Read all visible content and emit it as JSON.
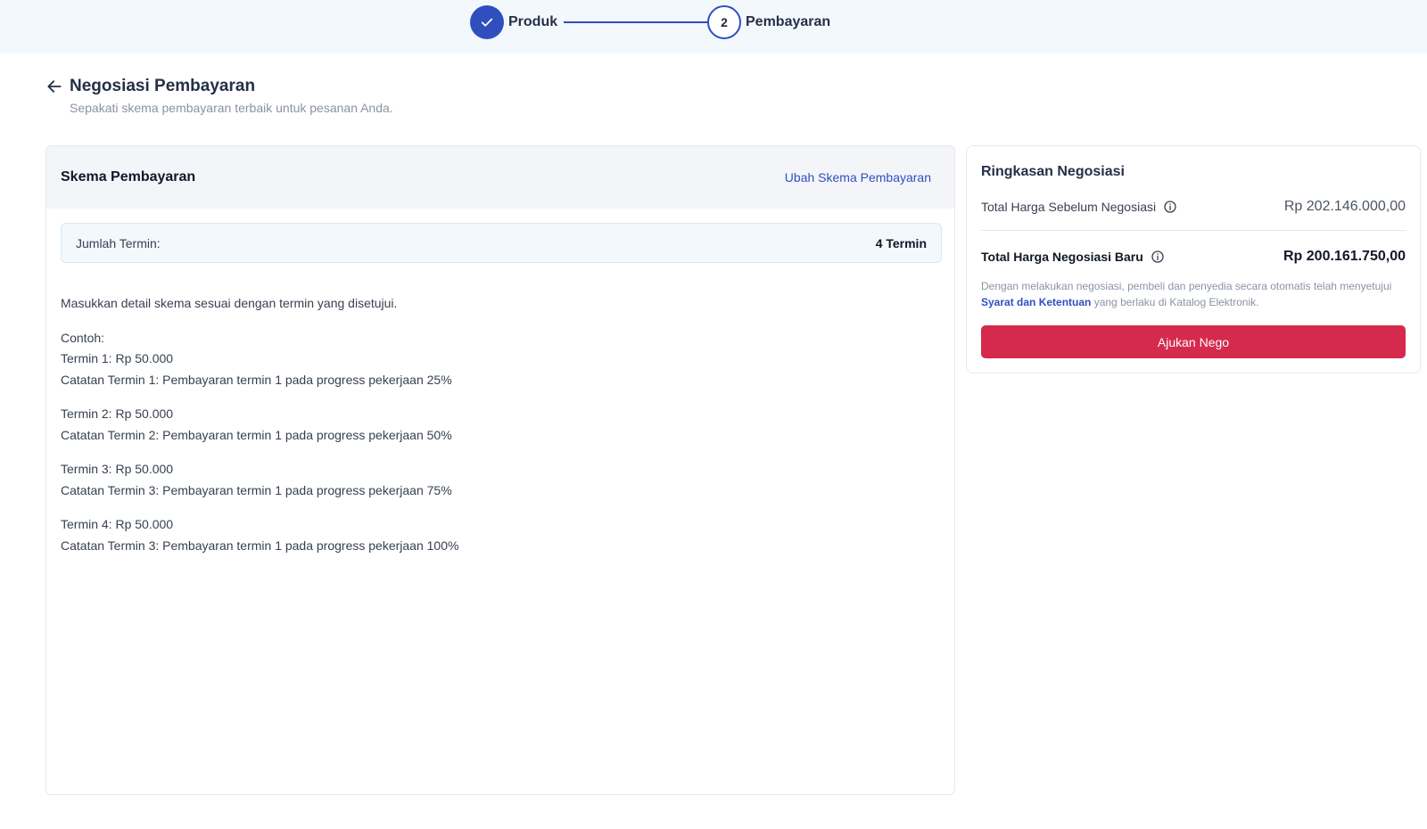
{
  "stepper": {
    "steps": [
      {
        "number": "1",
        "label": "Produk",
        "state": "done"
      },
      {
        "number": "2",
        "label": "Pembayaran",
        "state": "current"
      }
    ]
  },
  "header": {
    "title": "Negosiasi Pembayaran",
    "subtitle": "Sepakati skema pembayaran terbaik untuk pesanan Anda."
  },
  "schema": {
    "title": "Skema Pembayaran",
    "change_link": "Ubah Skema Pembayaran",
    "term_count_label": "Jumlah Termin:",
    "term_count_value": "4 Termin",
    "instruction": "Masukkan detail skema sesuai dengan termin yang disetujui.",
    "example_label": "Contoh:",
    "terms": [
      {
        "amount": "Termin 1: Rp 50.000",
        "note": "Catatan Termin 1: Pembayaran termin 1 pada progress pekerjaan 25%"
      },
      {
        "amount": "Termin 2: Rp 50.000",
        "note": "Catatan Termin 2: Pembayaran termin 1 pada progress pekerjaan 50%"
      },
      {
        "amount": "Termin 3: Rp 50.000",
        "note": "Catatan Termin 3: Pembayaran termin 1 pada progress pekerjaan 75%"
      },
      {
        "amount": "Termin 4: Rp 50.000",
        "note": "Catatan Termin 3: Pembayaran termin 1 pada progress pekerjaan 100%"
      }
    ]
  },
  "summary": {
    "title": "Ringkasan Negosiasi",
    "before_label": "Total Harga Sebelum Negosiasi",
    "before_value": "Rp 202.146.000,00",
    "new_label": "Total Harga Negosiasi Baru",
    "new_value": "Rp 200.161.750,00",
    "disclaimer_pre": "Dengan melakukan negosiasi, pembeli dan penyedia secara otomatis telah menyetujui ",
    "terms_link": "Syarat dan Ketentuan",
    "disclaimer_post": " yang berlaku di Katalog Elektronik.",
    "submit_label": "Ajukan Nego"
  },
  "colors": {
    "primary": "#2f4fbf",
    "cta": "#d52a4e",
    "stepper_bg": "#f3f8fd"
  },
  "icons": {
    "step_done": "check-icon",
    "back": "arrow-left-icon",
    "info": "info-circle-icon"
  }
}
